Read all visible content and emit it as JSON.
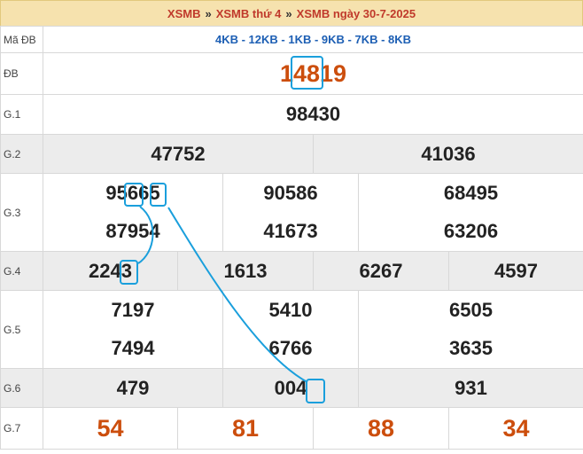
{
  "header": {
    "part1": "XSMB",
    "sep1": "»",
    "part2": "XSMB thứ 4",
    "sep2": "»",
    "part3": "XSMB ngày 30-7-2025"
  },
  "ma_db": {
    "label": "Mã ĐB",
    "value": "4KB - 12KB - 1KB - 9KB - 7KB - 8KB"
  },
  "db": {
    "label": "ĐB",
    "value": "14819"
  },
  "g1": {
    "label": "G.1",
    "values": [
      "98430"
    ]
  },
  "g2": {
    "label": "G.2",
    "values": [
      "47752",
      "41036"
    ]
  },
  "g3": {
    "label": "G.3",
    "values": [
      "95665",
      "90586",
      "68495",
      "87954",
      "41673",
      "63206"
    ]
  },
  "g4": {
    "label": "G.4",
    "values": [
      "2243",
      "1613",
      "6267",
      "4597"
    ]
  },
  "g5": {
    "label": "G.5",
    "values": [
      "7197",
      "5410",
      "6505",
      "7494",
      "6766",
      "3635"
    ]
  },
  "g6": {
    "label": "G.6",
    "values": [
      "479",
      "004",
      "931"
    ]
  },
  "g7": {
    "label": "G.7",
    "values": [
      "54",
      "81",
      "88",
      "34"
    ]
  },
  "colors": {
    "accent": "#cc4e0d",
    "link_blue": "#1d5fb4",
    "highlight": "#1a9fdc",
    "header_bg": "#f6e2ae"
  }
}
